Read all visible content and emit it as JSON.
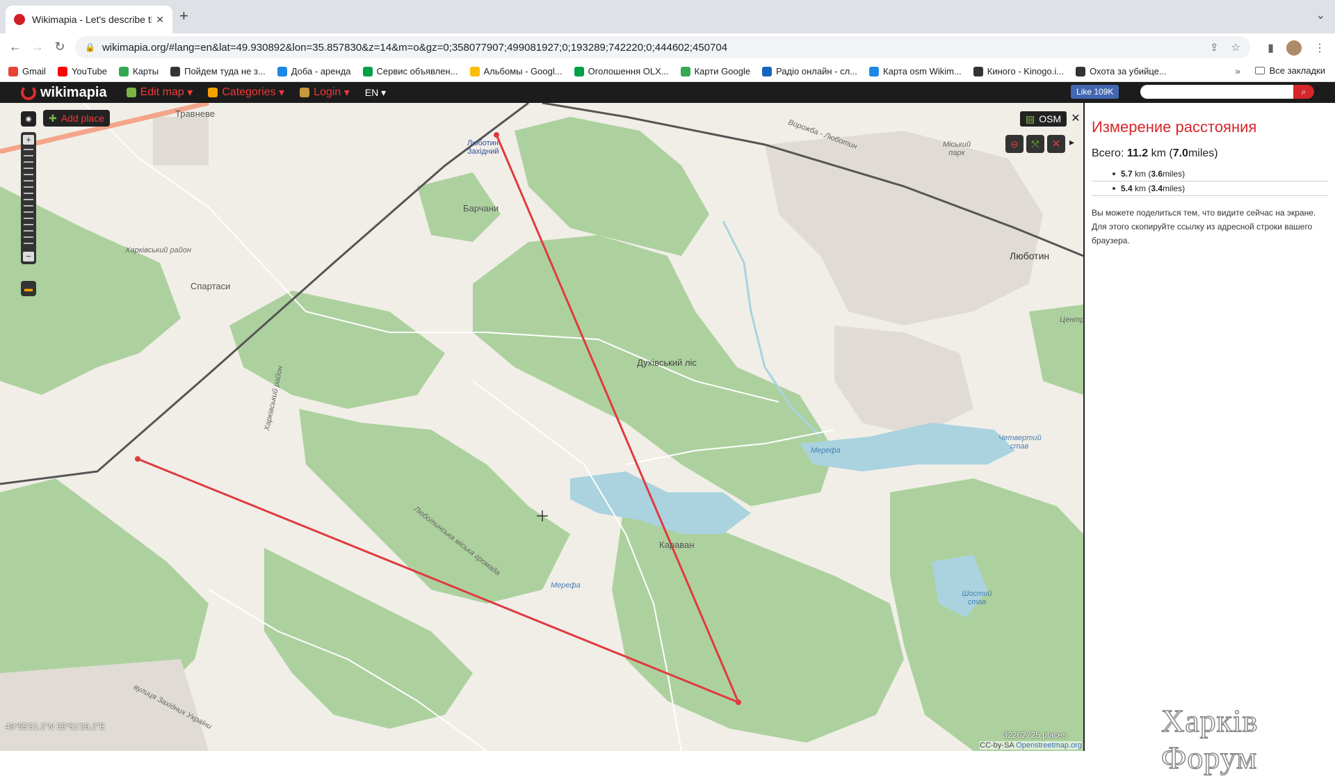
{
  "browser": {
    "tab_title": "Wikimapia - Let's describe the",
    "url": "wikimapia.org/#lang=en&lat=49.930892&lon=35.857830&z=14&m=o&gz=0;358077907;499081927;0;193289;742220;0;444602;450704",
    "bookmarks": [
      {
        "label": "Gmail",
        "color": "#ea4335"
      },
      {
        "label": "YouTube",
        "color": "#ff0000"
      },
      {
        "label": "Карты",
        "color": "#34a853"
      },
      {
        "label": "Пойдем туда не з...",
        "color": "#333333"
      },
      {
        "label": "Доба - аренда",
        "color": "#1e88e5"
      },
      {
        "label": "Сервис объявлен...",
        "color": "#00a046"
      },
      {
        "label": "Альбомы - Googl...",
        "color": "#fbbc04"
      },
      {
        "label": "Оголошення OLX...",
        "color": "#00a046"
      },
      {
        "label": "Карти Google",
        "color": "#34a853"
      },
      {
        "label": "Радіо онлайн - сл...",
        "color": "#1565c0"
      },
      {
        "label": "Карта osm Wikim...",
        "color": "#1e88e5"
      },
      {
        "label": "Киного - Kinogo.i...",
        "color": "#333333"
      },
      {
        "label": "Охота за убийце...",
        "color": "#333333"
      }
    ],
    "bookmarks_more": "»",
    "all_bookmarks": "Все закладки"
  },
  "site": {
    "logo": "wikimapia",
    "menu": {
      "edit_map": "Edit map",
      "categories": "Categories",
      "login": "Login",
      "lang": "EN"
    },
    "like": "Like 109K",
    "search_placeholder": ""
  },
  "map": {
    "add_place": "Add place",
    "layer": "OSM",
    "labels": {
      "travneve": "Травневе",
      "barchany": "Барчани",
      "spartasy": "Спартаси",
      "lyubotyn_zakh": "Люботин Західний",
      "lyubotyn": "Люботин",
      "dukh_lis": "Духівський ліс",
      "karavan": "Караван",
      "mereфа1": "Мерефа",
      "mereфа2": "Мерефа",
      "kharkiv_rayon1": "Харківський район",
      "kharkiv_rayon2": "Харківський район",
      "hromada": "Люботинська міська громада",
      "miskyi_park": "Міський парк",
      "chetvertyi": "Четвертий став",
      "shostyi": "Шостий став",
      "vorozhba": "Ворожба - Люботин",
      "zakhidna": "вулиця Західних України",
      "tsentr": "Центр"
    },
    "coords": "49°55'51.2\"N 35°51'28.2\"E",
    "places_count": "32262725 places",
    "attribution_prefix": "CC-by-SA",
    "attribution_link": "Openstreetmap.org"
  },
  "panel": {
    "title": "Измерение расстояния",
    "total_prefix": "Всего:",
    "total_km": "11.2",
    "total_miles": "7.0",
    "segments": [
      {
        "km": "5.7",
        "miles": "3.6"
      },
      {
        "km": "5.4",
        "miles": "3.4"
      }
    ],
    "km_unit": "km",
    "miles_unit": "miles",
    "note": "Вы можете поделиться тем, что видите сейчас на экране. Для этого скопируйте ссылку из адресной строки вашего браузера."
  },
  "watermark": "Харків Форум",
  "colors": {
    "accent": "#d6262a",
    "measure_line": "#e03a3e",
    "forest": "#add19e",
    "water": "#aad3df"
  }
}
